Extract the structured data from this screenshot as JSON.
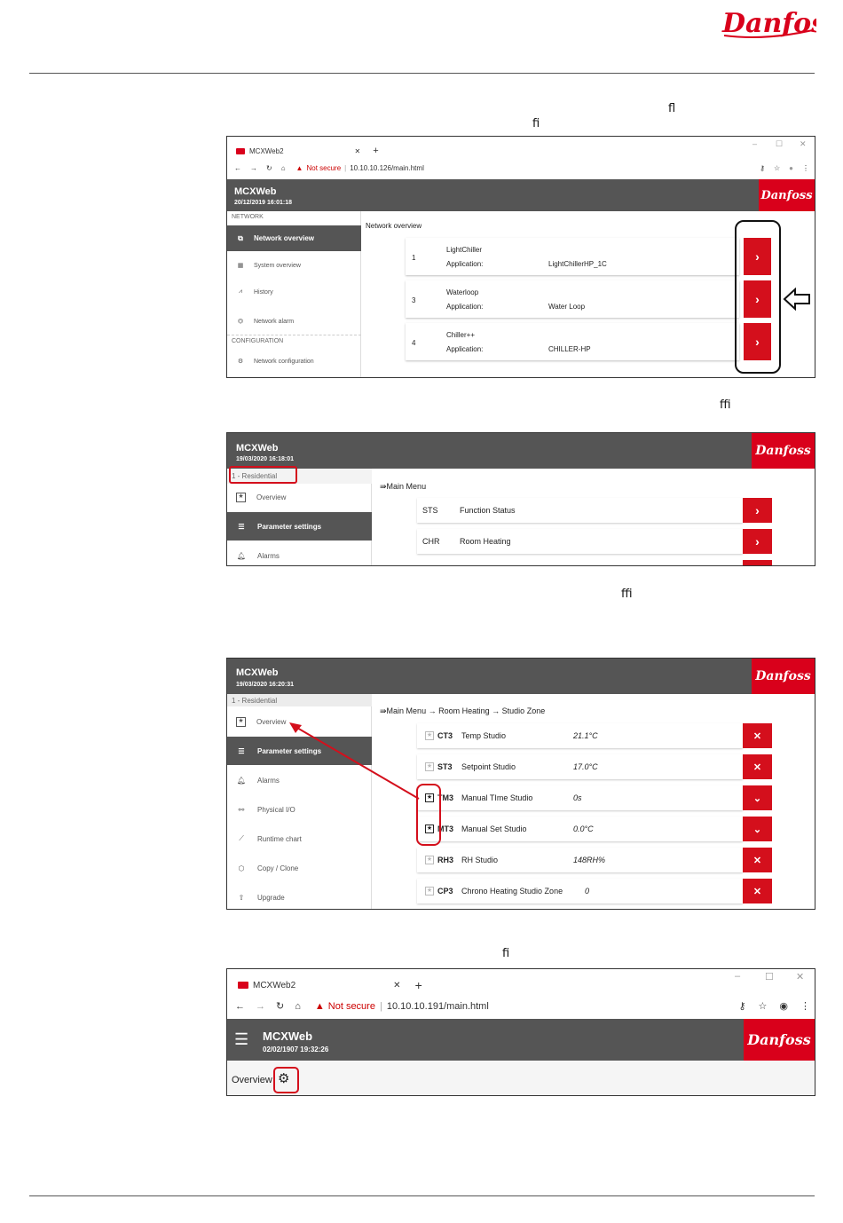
{
  "brand": "Danfoss",
  "ligatures": {
    "fl": "ﬂ",
    "fi": "ﬁ",
    "ffi": "ﬃ"
  },
  "shot1": {
    "tab_title": "MCXWeb2",
    "not_secure": "Not secure",
    "url": "10.10.10.126/main.html",
    "app_title": "MCXWeb",
    "datetime": "20/12/2019 16:01:18",
    "section_network": "NETWORK",
    "section_config": "CONFIGURATION",
    "nav": [
      "Network overview",
      "System overview",
      "History",
      "Network alarm",
      "Network configuration"
    ],
    "heading": "Network overview",
    "application_label": "Application:",
    "devices": [
      {
        "addr": "1",
        "name": "LightChiller",
        "app": "LightChillerHP_1C"
      },
      {
        "addr": "3",
        "name": "Waterloop",
        "app": "Water Loop"
      },
      {
        "addr": "4",
        "name": "Chiller++",
        "app": "CHILLER-HP"
      }
    ]
  },
  "shot2": {
    "app_title": "MCXWeb",
    "datetime": "19/03/2020 16:18:01",
    "device": "1 - Residential",
    "nav": [
      "Overview",
      "Parameter settings",
      "Alarms"
    ],
    "breadcrumb": "Main Menu",
    "rows": [
      {
        "code": "STS",
        "label": "Function Status"
      },
      {
        "code": "CHR",
        "label": "Room Heating"
      }
    ]
  },
  "shot3": {
    "app_title": "MCXWeb",
    "datetime": "19/03/2020 16:20:31",
    "device": "1 - Residential",
    "nav": [
      "Overview",
      "Parameter settings",
      "Alarms",
      "Physical I/O",
      "Runtime chart",
      "Copy / Clone",
      "Upgrade"
    ],
    "breadcrumb": [
      "Main Menu",
      "Room Heating",
      "Studio Zone"
    ],
    "rows": [
      {
        "code": "CT3",
        "label": "Temp Studio",
        "value": "21.1°C",
        "starred": false,
        "action": "✕"
      },
      {
        "code": "ST3",
        "label": "Setpoint Studio",
        "value": "17.0°C",
        "starred": false,
        "action": "✕"
      },
      {
        "code": "TM3",
        "label": "Manual TIme Studio",
        "value": "0s",
        "starred": true,
        "action": "⌄"
      },
      {
        "code": "MT3",
        "label": "Manual Set Studio",
        "value": "0.0°C",
        "starred": true,
        "action": "⌄"
      },
      {
        "code": "RH3",
        "label": "RH Studio",
        "value": "148RH%",
        "starred": false,
        "action": "✕"
      },
      {
        "code": "CP3",
        "label": "Chrono Heating Studio Zone",
        "value": "0",
        "starred": false,
        "action": "✕"
      }
    ]
  },
  "shot4": {
    "tab_title": "MCXWeb2",
    "not_secure": "Not secure",
    "url": "10.10.10.191/main.html",
    "app_title": "MCXWeb",
    "datetime": "02/02/1907 19:32:26",
    "page_label": "Overview"
  }
}
